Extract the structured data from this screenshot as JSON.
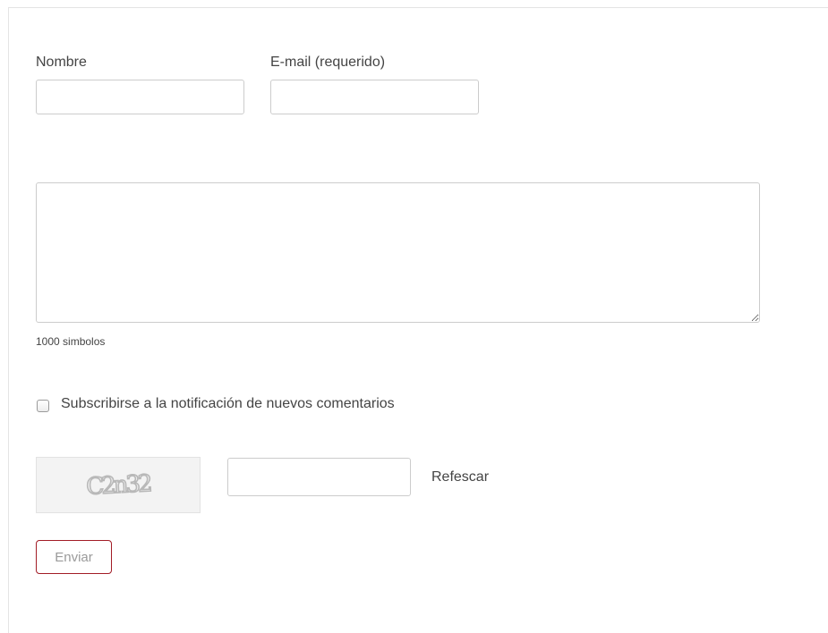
{
  "form": {
    "name_label": "Nombre",
    "name_value": "",
    "email_label": "E-mail (requerido)",
    "email_value": "",
    "comment_value": "",
    "char_counter": "1000 simbolos",
    "subscribe_label": "Subscribirse a la notificación de nuevos comentarios",
    "subscribe_checked": false,
    "captcha_text": "C2n32",
    "captcha_value": "",
    "refresh_label": "Refescar",
    "submit_label": "Enviar"
  },
  "colors": {
    "submit_border": "#a21c26",
    "input_border": "#cccccc",
    "text": "#444444"
  }
}
